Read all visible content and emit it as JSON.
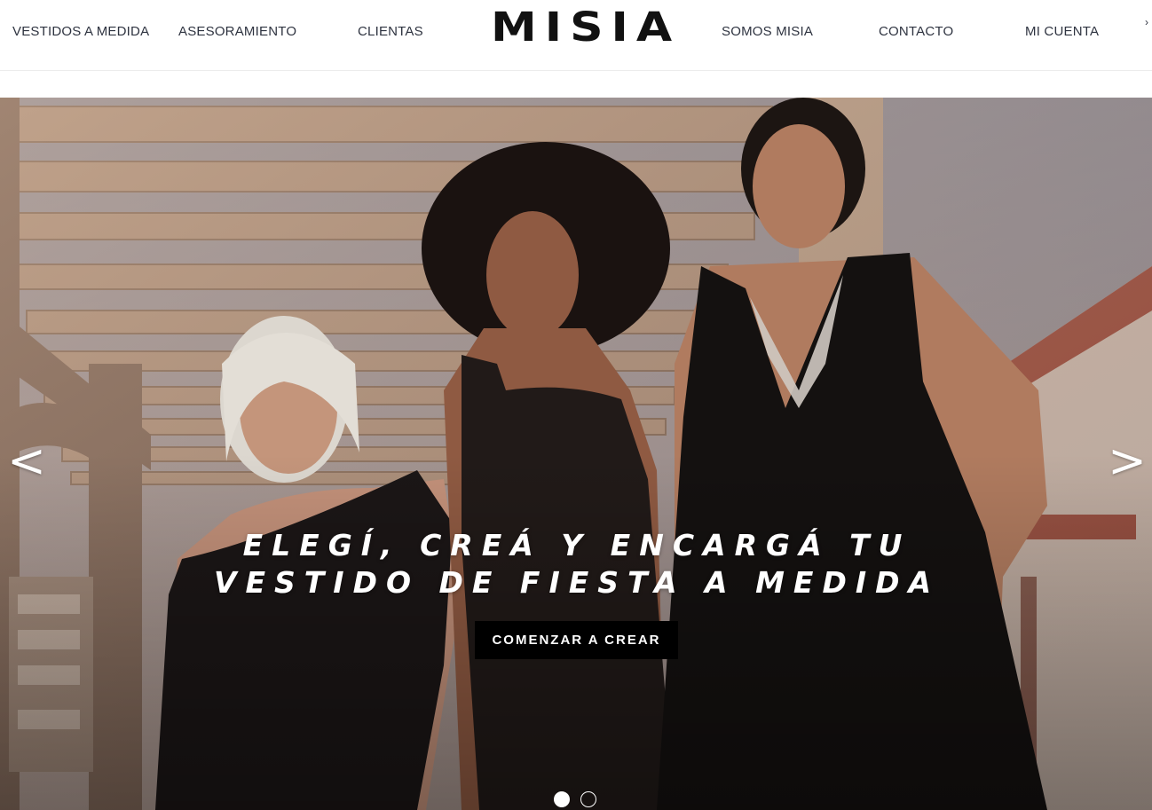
{
  "header": {
    "logo": "MISIA",
    "nav_left": [
      {
        "label": "VESTIDOS A MEDIDA"
      },
      {
        "label": "ASESORAMIENTO"
      },
      {
        "label": "CLIENTAS"
      }
    ],
    "nav_right": [
      {
        "label": "SOMOS MISIA"
      },
      {
        "label": "CONTACTO"
      },
      {
        "label": "MI CUENTA"
      }
    ],
    "edge_icon": "chevron-icon"
  },
  "hero": {
    "headline_line1": "ELEGÍ, CREÁ Y ENCARGÁ TU",
    "headline_line2": "VESTIDO DE FIESTA A MEDIDA",
    "cta_label": "COMENZAR A CREAR",
    "prev_arrow": "<",
    "next_arrow": ">",
    "slides_total": 2,
    "slide_active": 1,
    "image_description_icon": "photo-three-women-in-black-dresses"
  },
  "colors": {
    "nav_text": "#2e3340",
    "logo": "#111111",
    "cta_background": "#000000",
    "cta_text": "#ffffff",
    "headline": "#ffffff"
  }
}
